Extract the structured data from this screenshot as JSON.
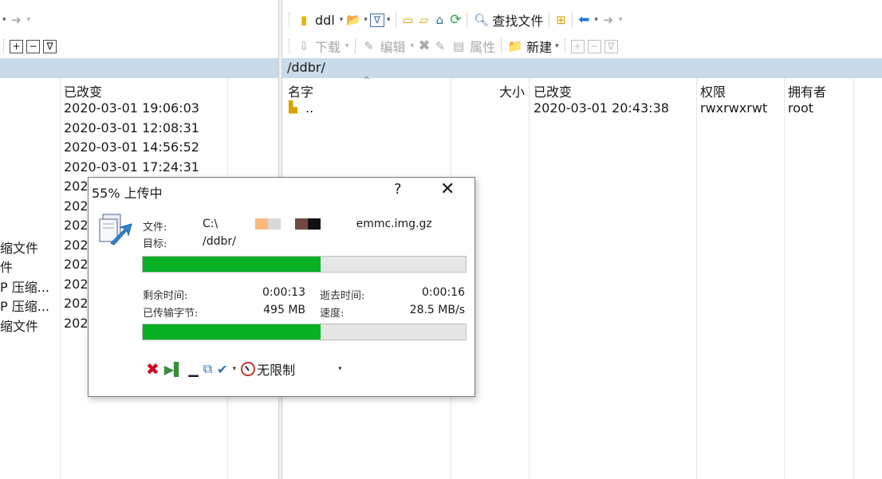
{
  "left_toolbar": {
    "nav_drop": "▾",
    "forward_icon": "arrow-right-icon"
  },
  "right_toolbar": {
    "location": "ddl",
    "find_files": "查找文件",
    "download": "下载",
    "edit": "编辑",
    "properties": "属性",
    "new": "新建"
  },
  "remote": {
    "path": "/ddbr/",
    "columns": {
      "name": "名字",
      "size": "大小",
      "changed": "已改变",
      "rights": "权限",
      "owner": "拥有者"
    },
    "rows": [
      {
        "name": "..",
        "size": "",
        "changed": "2020-03-01 20:43:38",
        "rights": "rwxrwxrwt",
        "owner": "root"
      }
    ]
  },
  "local": {
    "columns": {
      "changed": "已改变"
    },
    "dates": [
      "2020-03-01  19:06:03",
      "2020-03-01  12:08:31",
      "2020-03-01  14:56:52",
      "2020-03-01  17:24:31",
      "202",
      "202",
      "202",
      "202",
      "202",
      "202",
      "202",
      "202"
    ],
    "types": [
      "缩文件",
      "件",
      "P 压缩...",
      "P 压缩...",
      "缩文件"
    ]
  },
  "dialog": {
    "title": "55% 上传中",
    "help": "?",
    "close": "✕",
    "file_label": "文件:",
    "file_prefix": "C:\\",
    "file_suffix": "emmc.img.gz",
    "target_label": "目标:",
    "target_value": "/ddbr/",
    "progress_file": 0.55,
    "remaining_label": "剩余时间:",
    "remaining_value": "0:00:13",
    "elapsed_label": "逝去时间:",
    "elapsed_value": "0:00:16",
    "bytes_label": "已传输字节:",
    "bytes_value": "495 MB",
    "speed_label": "速度:",
    "speed_value": "28.5 MB/s",
    "progress_total": 0.55,
    "speed_limit": "无限制",
    "colors": {
      "progress": "#06b025",
      "swatch_orange": "#f9b979",
      "swatch_gray": "#d9d9d9",
      "swatch_brown": "#6e4a44",
      "swatch_black": "#111111"
    }
  }
}
